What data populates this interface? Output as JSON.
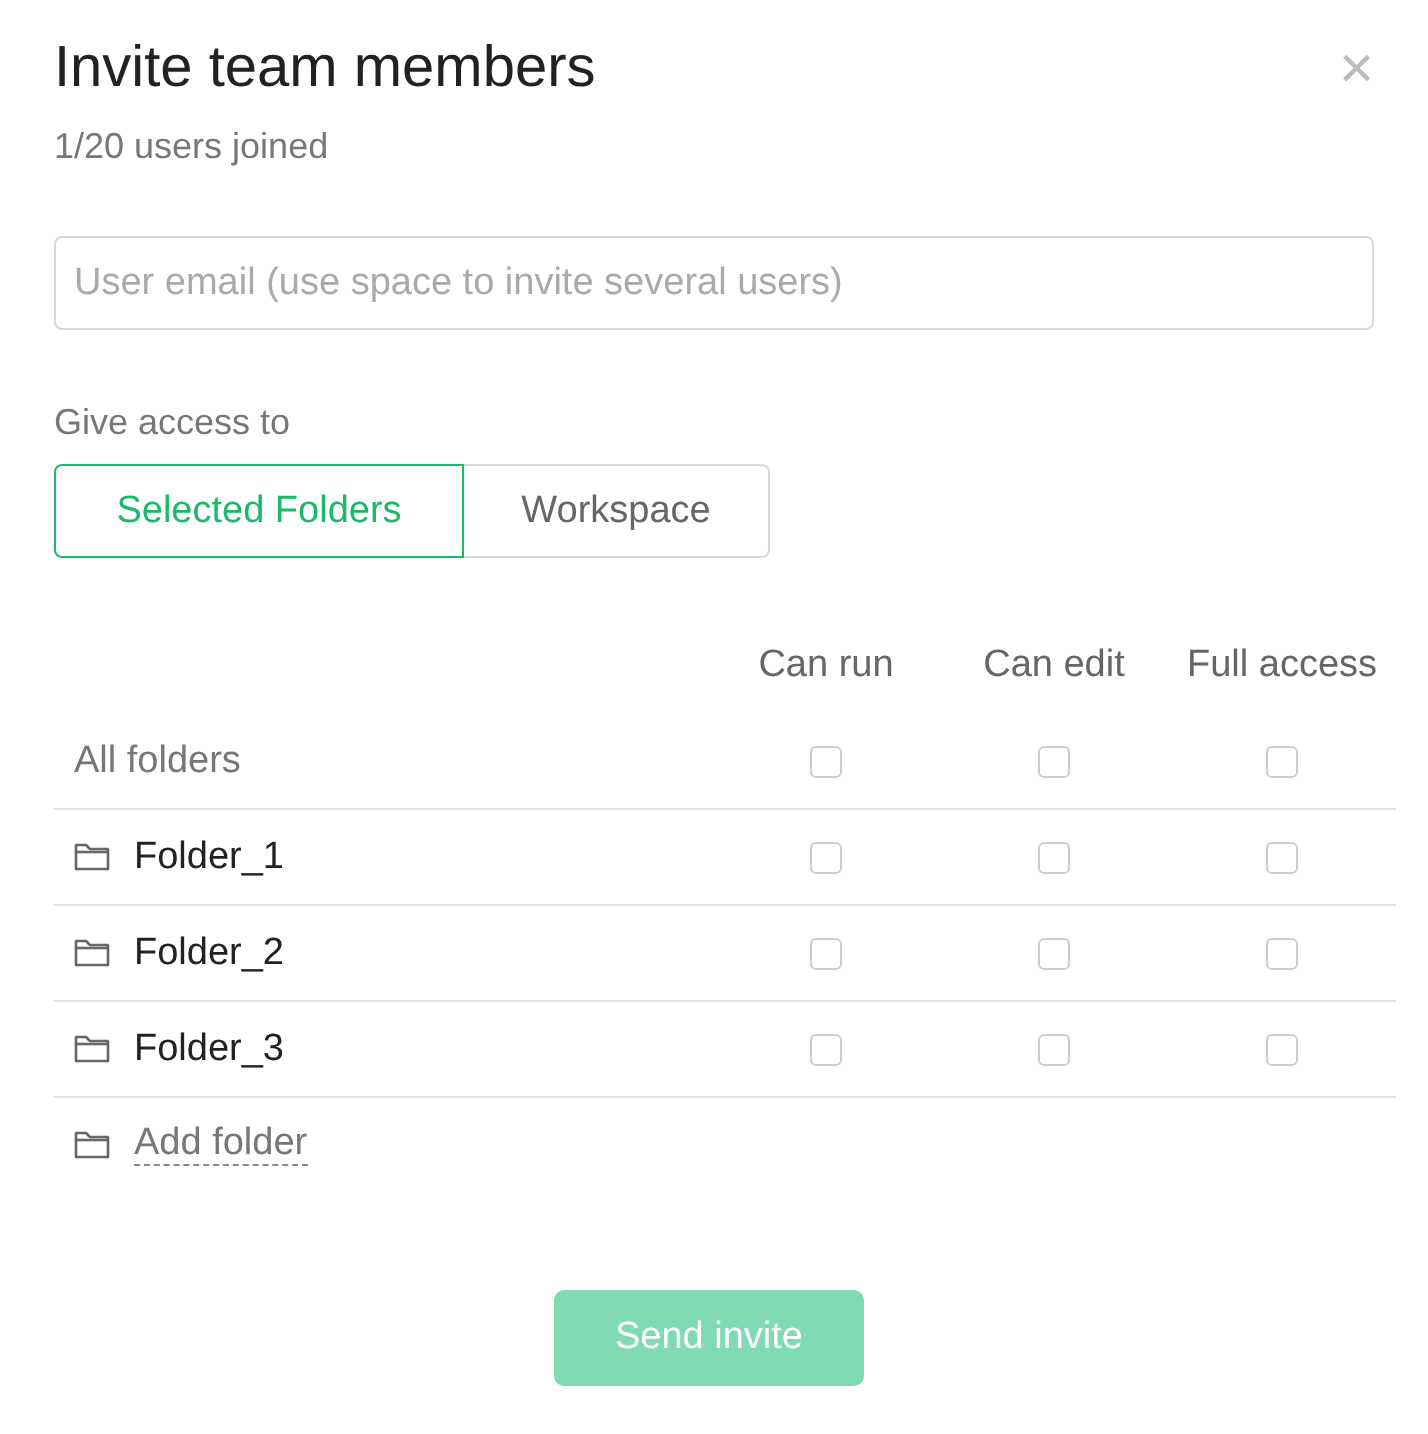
{
  "dialog": {
    "title": "Invite team members",
    "subtitle": "1/20 users joined",
    "close": "×"
  },
  "email": {
    "placeholder": "User email (use space to invite several users)"
  },
  "access": {
    "label": "Give access to",
    "options": [
      {
        "label": "Selected Folders",
        "selected": true
      },
      {
        "label": "Workspace",
        "selected": false
      }
    ]
  },
  "permissions": {
    "columns": [
      "Can run",
      "Can edit",
      "Full access"
    ],
    "rows": [
      {
        "kind": "all",
        "name": "All folders",
        "can_run": false,
        "can_edit": false,
        "full_access": false
      },
      {
        "kind": "folder",
        "name": "Folder_1",
        "can_run": false,
        "can_edit": false,
        "full_access": false
      },
      {
        "kind": "folder",
        "name": "Folder_2",
        "can_run": false,
        "can_edit": false,
        "full_access": false
      },
      {
        "kind": "folder",
        "name": "Folder_3",
        "can_run": false,
        "can_edit": false,
        "full_access": false
      }
    ],
    "add_folder": "Add folder"
  },
  "send_button": {
    "label": "Send invite",
    "disabled": true
  }
}
